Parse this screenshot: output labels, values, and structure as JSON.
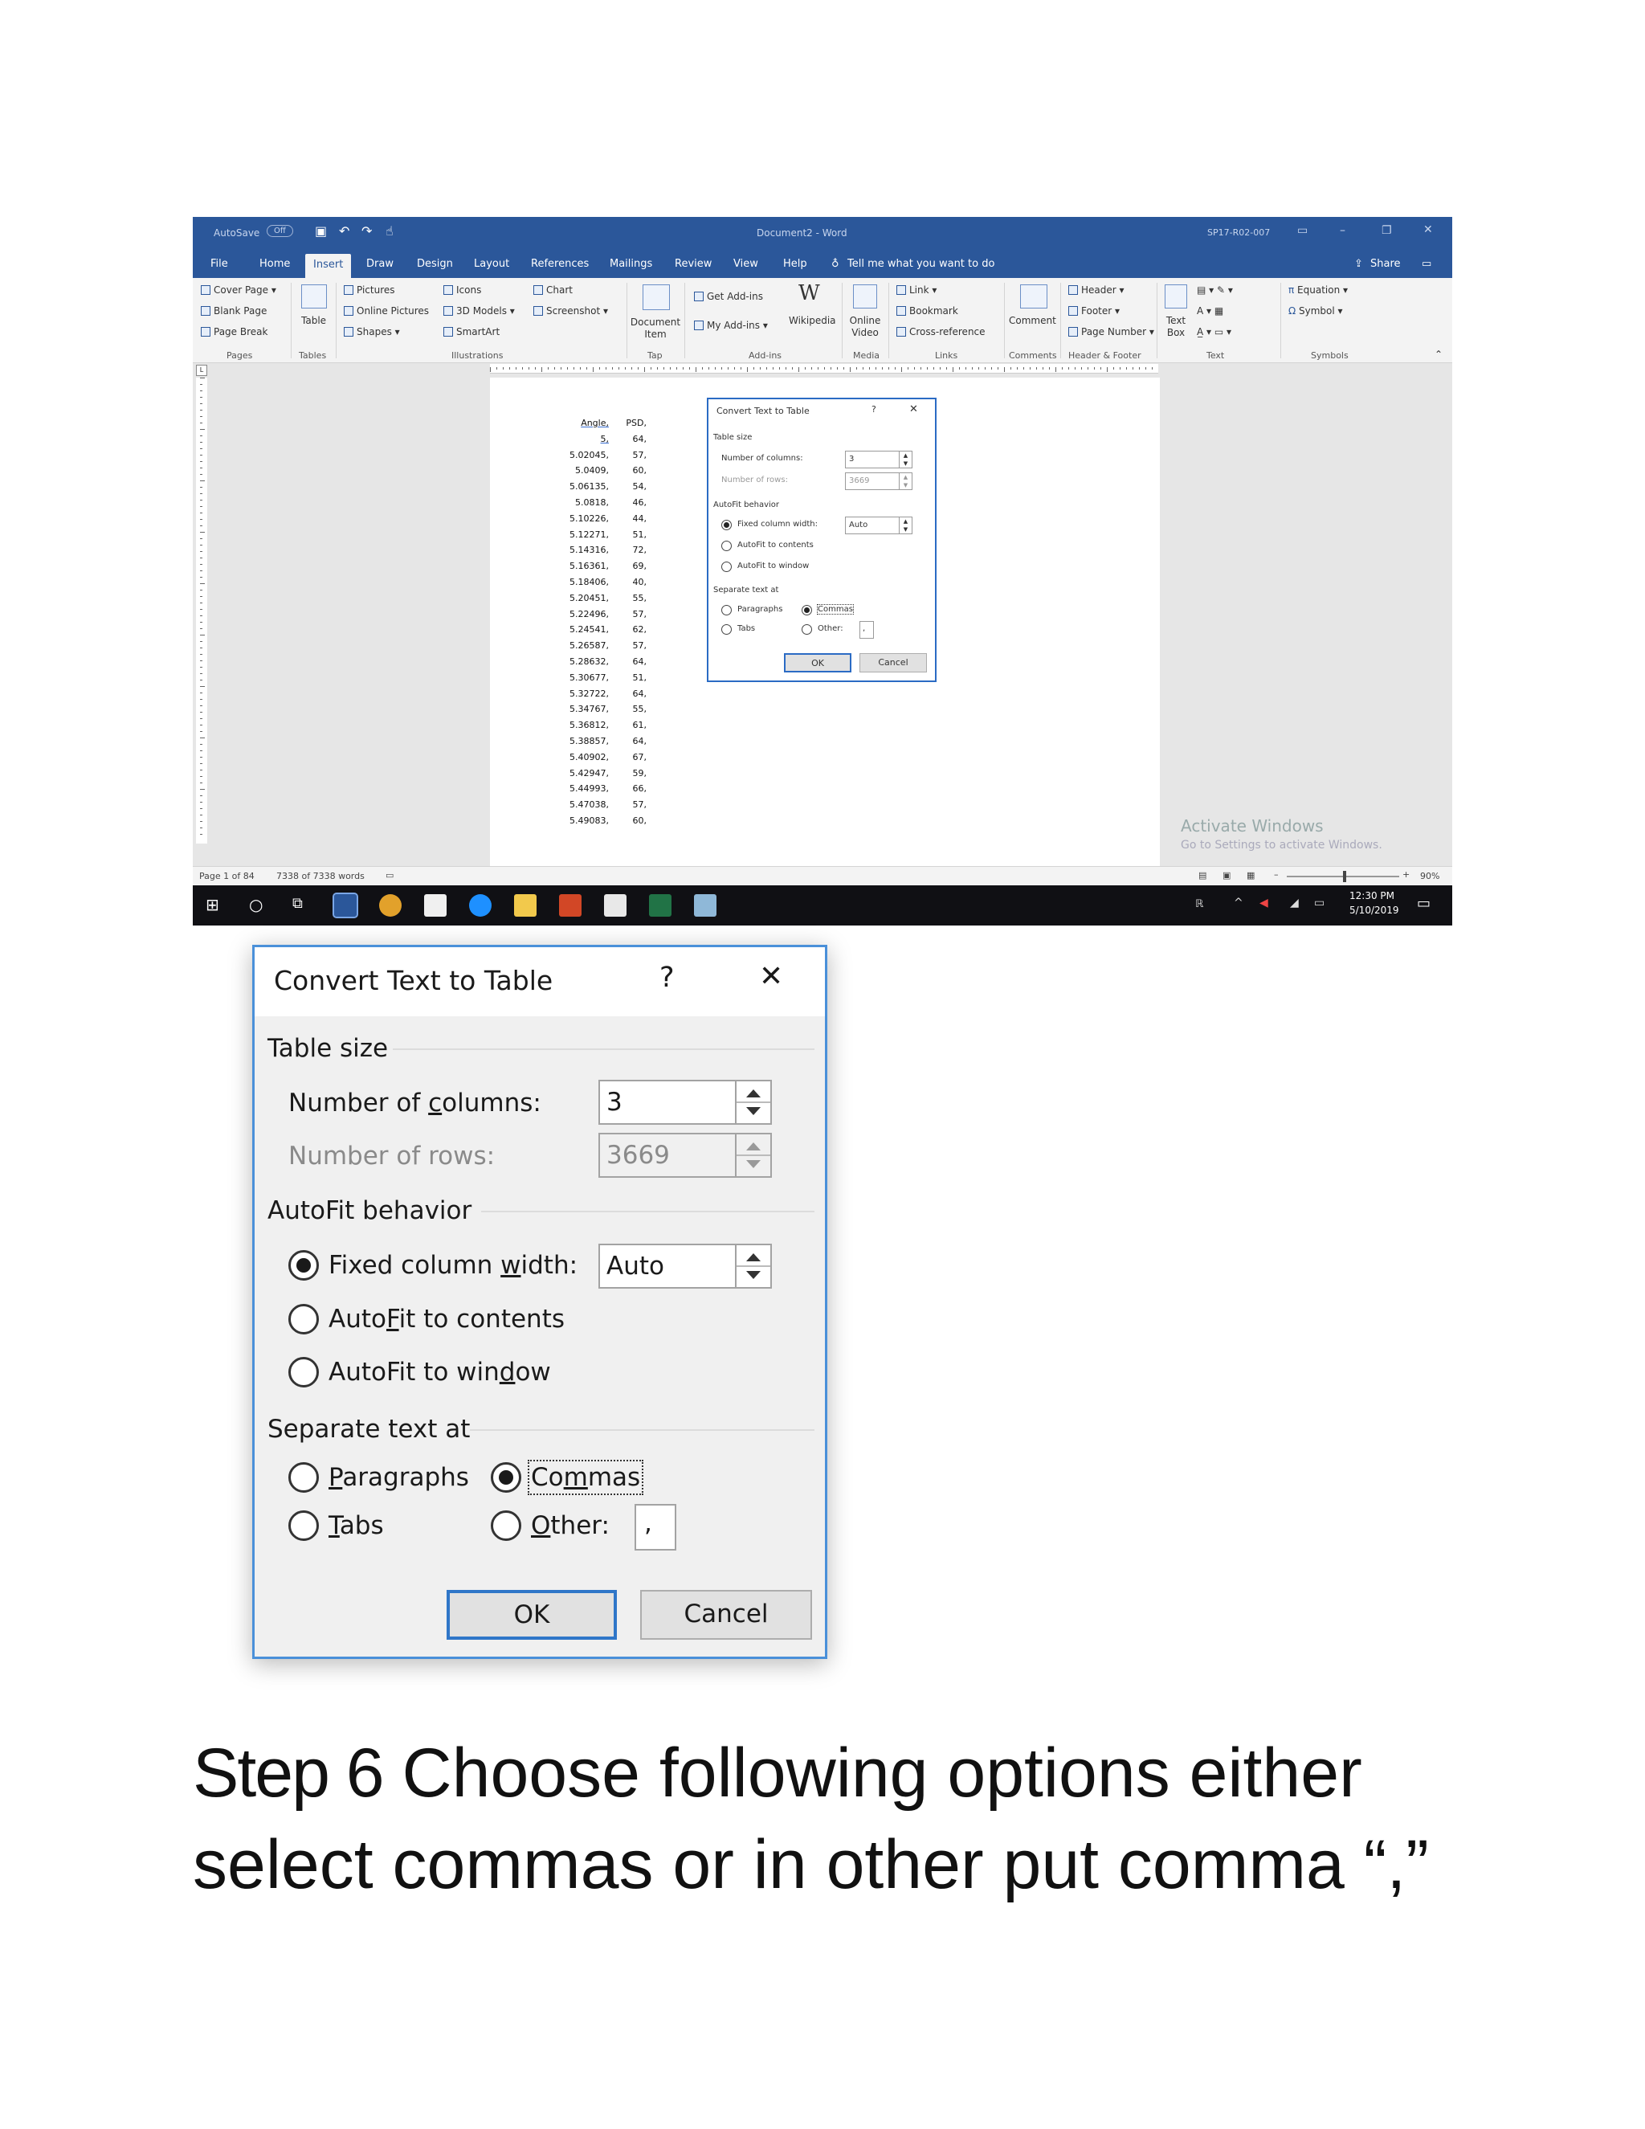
{
  "word": {
    "autosave_label": "AutoSave",
    "autosave_state": "Off",
    "window_title": "Document2 - Word",
    "account": "SP17-R02-007",
    "menu_tabs": [
      "File",
      "Home",
      "Insert",
      "Draw",
      "Design",
      "Layout",
      "References",
      "Mailings",
      "Review",
      "View",
      "Help"
    ],
    "active_tab": "Insert",
    "tell_me": "Tell me what you want to do",
    "share": "Share",
    "ribbon": {
      "pages": {
        "items": [
          "Cover Page",
          "Blank Page",
          "Page Break"
        ],
        "label": "Pages"
      },
      "tables": {
        "items": [
          "Table"
        ],
        "label": "Tables"
      },
      "illustrations": {
        "items": [
          "Pictures",
          "Online Pictures",
          "Shapes",
          "Icons",
          "3D Models",
          "SmartArt",
          "Chart",
          "Screenshot"
        ],
        "label": "Illustrations"
      },
      "tap": {
        "items": [
          "Document Item"
        ],
        "label": "Tap"
      },
      "addins": {
        "items": [
          "Get Add-ins",
          "My Add-ins",
          "Wikipedia"
        ],
        "label": "Add-ins"
      },
      "media": {
        "items": [
          "Online Video"
        ],
        "label": "Media"
      },
      "links": {
        "items": [
          "Link",
          "Bookmark",
          "Cross-reference"
        ],
        "label": "Links"
      },
      "comments": {
        "items": [
          "Comment"
        ],
        "label": "Comments"
      },
      "header_footer": {
        "items": [
          "Header",
          "Footer",
          "Page Number"
        ],
        "label": "Header & Footer"
      },
      "text": {
        "items": [
          "Text Box"
        ],
        "label": "Text"
      },
      "symbols": {
        "items": [
          "Equation",
          "Symbol"
        ],
        "label": "Symbols"
      }
    },
    "document_lines": [
      [
        "Angle,",
        "PSD,"
      ],
      [
        "5,",
        "64,"
      ],
      [
        "5.02045,",
        "57,"
      ],
      [
        "5.0409,",
        "60,"
      ],
      [
        "5.06135,",
        "54,"
      ],
      [
        "5.0818,",
        "46,"
      ],
      [
        "5.10226,",
        "44,"
      ],
      [
        "5.12271,",
        "51,"
      ],
      [
        "5.14316,",
        "72,"
      ],
      [
        "5.16361,",
        "69,"
      ],
      [
        "5.18406,",
        "40,"
      ],
      [
        "5.20451,",
        "55,"
      ],
      [
        "5.22496,",
        "57,"
      ],
      [
        "5.24541,",
        "62,"
      ],
      [
        "5.26587,",
        "57,"
      ],
      [
        "5.28632,",
        "64,"
      ],
      [
        "5.30677,",
        "51,"
      ],
      [
        "5.32722,",
        "64,"
      ],
      [
        "5.34767,",
        "55,"
      ],
      [
        "5.36812,",
        "61,"
      ],
      [
        "5.38857,",
        "64,"
      ],
      [
        "5.40902,",
        "67,"
      ],
      [
        "5.42947,",
        "59,"
      ],
      [
        "5.44993,",
        "66,"
      ],
      [
        "5.47038,",
        "57,"
      ],
      [
        "5.49083,",
        "60,"
      ]
    ],
    "activate_title": "Activate Windows",
    "activate_sub": "Go to Settings to activate Windows.",
    "status": {
      "page": "Page 1 of 84",
      "words": "7338 of 7338 words",
      "zoom": "90%"
    },
    "clock": {
      "time": "12:30 PM",
      "date": "5/10/2019"
    }
  },
  "dialog": {
    "title": "Convert Text to Table",
    "help": "?",
    "close": "✕",
    "table_size": "Table size",
    "columns_label_pre": "Number of ",
    "columns_label_u": "c",
    "columns_label_post": "olumns:",
    "columns_value": "3",
    "rows_label": "Number of rows:",
    "rows_value": "3669",
    "autofit": "AutoFit behavior",
    "fixed_pre": "Fixed column ",
    "fixed_u": "w",
    "fixed_post": "idth:",
    "fixed_value": "Auto",
    "autofit_contents_pre": "Auto",
    "autofit_contents_u": "F",
    "autofit_contents_post": "it to contents",
    "autofit_window_pre": "AutoFit to win",
    "autofit_window_u": "d",
    "autofit_window_post": "ow",
    "separate": "Separate text at",
    "paragraphs_u": "P",
    "paragraphs_post": "aragraphs",
    "commas_pre": "Co",
    "commas_u": "m",
    "commas_post": "mas",
    "tabs_u": "T",
    "tabs_post": "abs",
    "other_u": "O",
    "other_post": "ther:",
    "other_value": ",",
    "ok": "OK",
    "cancel": "Cancel",
    "selected_fit": "fixed",
    "selected_separator": "commas"
  },
  "mini_dialog": {
    "title": "Convert Text to Table",
    "table_size": "Table size",
    "columns_label": "Number of columns:",
    "columns_value": "3",
    "rows_label": "Number of rows:",
    "rows_value": "3669",
    "autofit": "AutoFit behavior",
    "fixed": "Fixed column width:",
    "fixed_value": "Auto",
    "autofit_contents": "AutoFit to contents",
    "autofit_window": "AutoFit to window",
    "separate": "Separate text at",
    "paragraphs": "Paragraphs",
    "commas": "Commas",
    "tabs": "Tabs",
    "other": "Other:",
    "other_value": ",",
    "ok": "OK",
    "cancel": "Cancel"
  },
  "caption": {
    "step": "Step 6",
    "line1": " Choose following options either",
    "line2": "select commas or in other put comma “,”"
  }
}
